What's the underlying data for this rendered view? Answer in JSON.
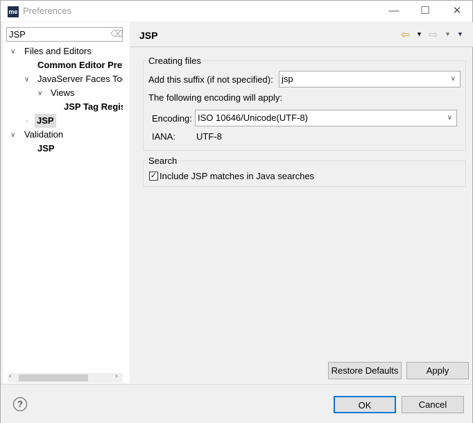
{
  "window": {
    "title": "Preferences",
    "logo": "me",
    "controls": [
      "minimize-icon",
      "maximize-icon",
      "close-icon"
    ]
  },
  "sidebar": {
    "filter_value": "JSP",
    "items": [
      {
        "label": "Files and Editors",
        "bold": false,
        "expanded": true
      },
      {
        "label": "Common Editor Preferences",
        "bold": true
      },
      {
        "label": "JavaServer Faces Tools",
        "bold": false,
        "expanded": true
      },
      {
        "label": "Views",
        "bold": false,
        "expanded": true
      },
      {
        "label": "JSP Tag Registry",
        "bold": true
      },
      {
        "label": "JSP",
        "bold": true,
        "selected": true,
        "expanded": false
      },
      {
        "label": "Validation",
        "bold": false,
        "expanded": true
      },
      {
        "label": "JSP",
        "bold": true
      }
    ]
  },
  "page": {
    "title": "JSP",
    "creating_files": {
      "legend": "Creating files",
      "suffix_label": "Add this suffix (if not specified):",
      "suffix_value": "jsp",
      "encoding_note": "The following encoding will apply:",
      "encoding_label": "Encoding:",
      "encoding_value": "ISO 10646/Unicode(UTF-8)",
      "iana_label": "IANA:",
      "iana_value": "UTF-8"
    },
    "search": {
      "legend": "Search",
      "checkbox_label": "Include JSP matches in Java searches",
      "checked": true
    },
    "restore_defaults": "Restore Defaults",
    "apply": "Apply"
  },
  "footer": {
    "ok": "OK",
    "cancel": "Cancel"
  },
  "colors": {
    "accent": "#0078d7",
    "back_arrow": "#e0a020"
  }
}
